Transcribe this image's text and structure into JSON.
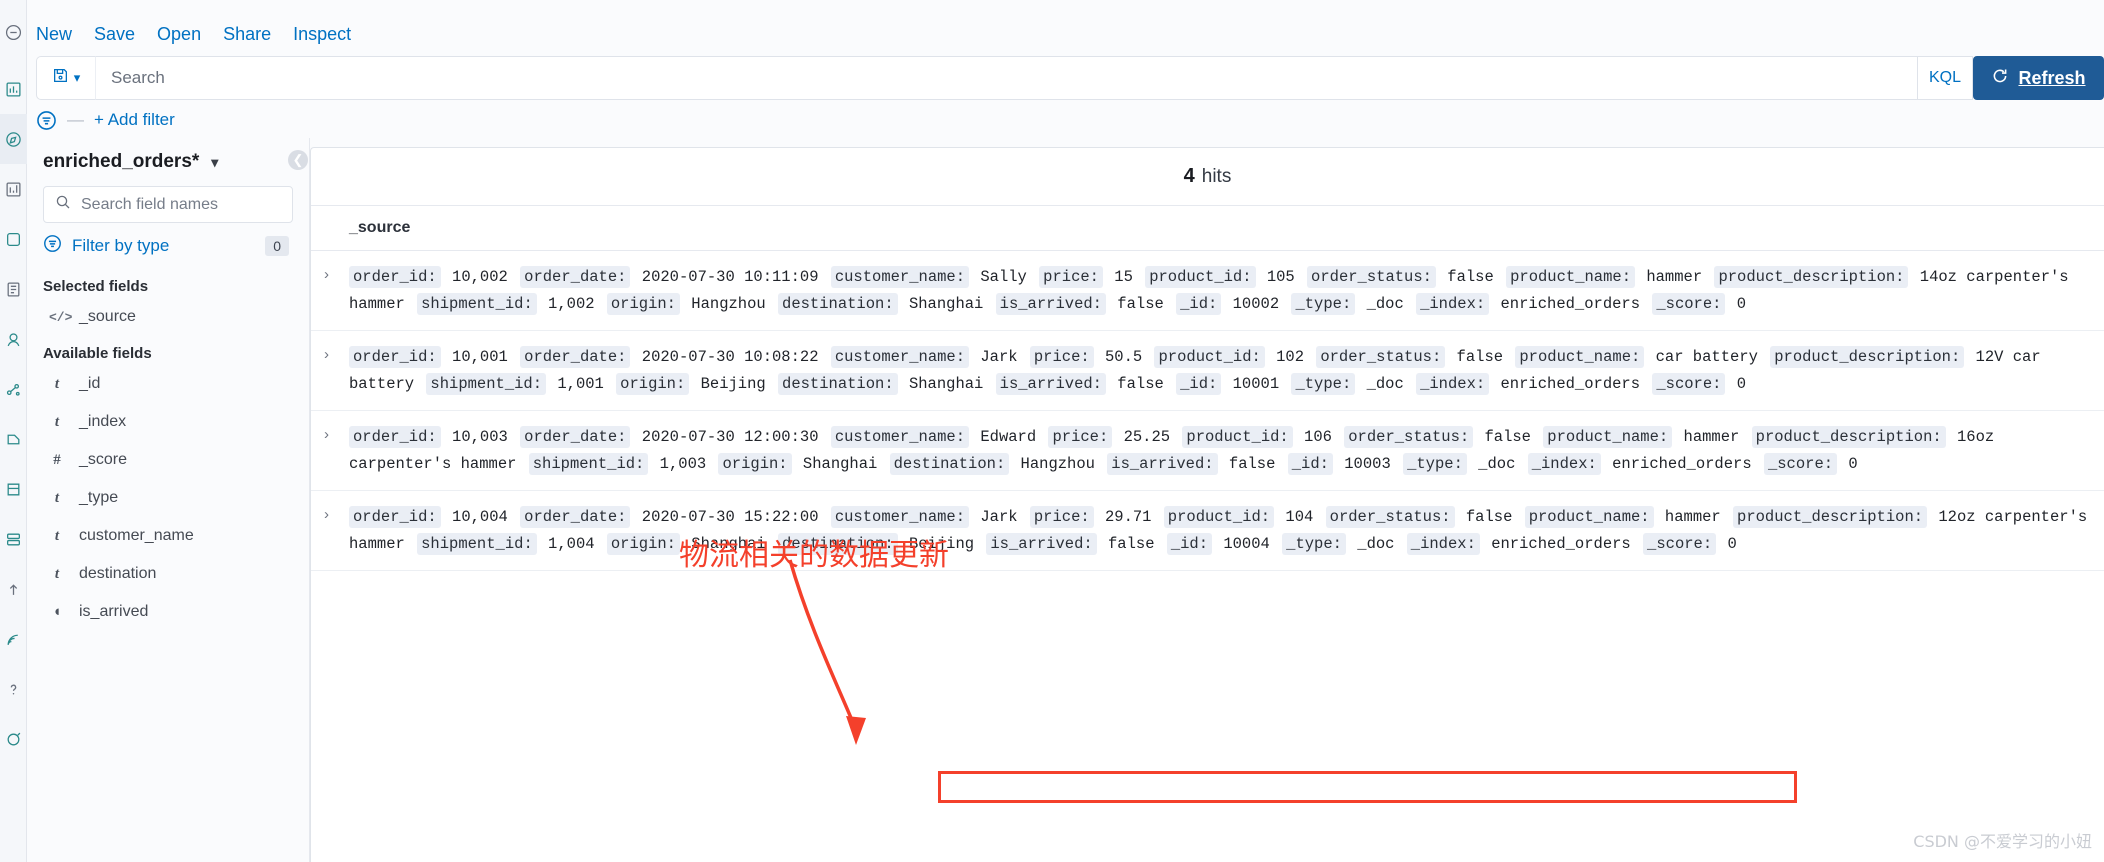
{
  "top_menu": {
    "items": [
      {
        "label": "New",
        "name": "new"
      },
      {
        "label": "Save",
        "name": "save"
      },
      {
        "label": "Open",
        "name": "open"
      },
      {
        "label": "Share",
        "name": "share"
      },
      {
        "label": "Inspect",
        "name": "inspect"
      }
    ]
  },
  "query_bar": {
    "search_placeholder": "Search",
    "language_label": "KQL",
    "refresh_label": "Refresh"
  },
  "filter_bar": {
    "add_filter_label": "+ Add filter",
    "dash": "—"
  },
  "sidebar": {
    "index_pattern": "enriched_orders*",
    "field_search_placeholder": "Search field names",
    "filter_by_type_label": "Filter by type",
    "filter_by_type_count": "0",
    "selected_fields_title": "Selected fields",
    "available_fields_title": "Available fields",
    "selected_fields": [
      {
        "name": "_source",
        "type": "source"
      }
    ],
    "available_fields": [
      {
        "name": "_id",
        "type": "string"
      },
      {
        "name": "_index",
        "type": "string"
      },
      {
        "name": "_score",
        "type": "number"
      },
      {
        "name": "_type",
        "type": "string"
      },
      {
        "name": "customer_name",
        "type": "string"
      },
      {
        "name": "destination",
        "type": "string"
      },
      {
        "name": "is_arrived",
        "type": "boolean"
      }
    ]
  },
  "main": {
    "hits_count": "4",
    "hits_label": "hits",
    "column_header": "_source",
    "documents": [
      {
        "fields": [
          {
            "key": "order_id:",
            "value": "10,002"
          },
          {
            "key": "order_date:",
            "value": "2020-07-30 10:11:09"
          },
          {
            "key": "customer_name:",
            "value": "Sally"
          },
          {
            "key": "price:",
            "value": "15"
          },
          {
            "key": "product_id:",
            "value": "105"
          },
          {
            "key": "order_status:",
            "value": "false"
          },
          {
            "key": "product_name:",
            "value": "hammer"
          },
          {
            "key": "product_description:",
            "value": "14oz carpenter's hammer"
          },
          {
            "key": "shipment_id:",
            "value": "1,002"
          },
          {
            "key": "origin:",
            "value": "Hangzhou"
          },
          {
            "key": "destination:",
            "value": "Shanghai"
          },
          {
            "key": "is_arrived:",
            "value": "false"
          },
          {
            "key": "_id:",
            "value": "10002"
          },
          {
            "key": "_type:",
            "value": "_doc"
          },
          {
            "key": "_index:",
            "value": "enriched_orders"
          },
          {
            "key": "_score:",
            "value": "0"
          }
        ]
      },
      {
        "fields": [
          {
            "key": "order_id:",
            "value": "10,001"
          },
          {
            "key": "order_date:",
            "value": "2020-07-30 10:08:22"
          },
          {
            "key": "customer_name:",
            "value": "Jark"
          },
          {
            "key": "price:",
            "value": "50.5"
          },
          {
            "key": "product_id:",
            "value": "102"
          },
          {
            "key": "order_status:",
            "value": "false"
          },
          {
            "key": "product_name:",
            "value": "car battery"
          },
          {
            "key": "product_description:",
            "value": "12V car battery"
          },
          {
            "key": "shipment_id:",
            "value": "1,001"
          },
          {
            "key": "origin:",
            "value": "Beijing"
          },
          {
            "key": "destination:",
            "value": "Shanghai"
          },
          {
            "key": "is_arrived:",
            "value": "false"
          },
          {
            "key": "_id:",
            "value": "10001"
          },
          {
            "key": "_type:",
            "value": "_doc"
          },
          {
            "key": "_index:",
            "value": "enriched_orders"
          },
          {
            "key": "_score:",
            "value": "0"
          }
        ]
      },
      {
        "fields": [
          {
            "key": "order_id:",
            "value": "10,003"
          },
          {
            "key": "order_date:",
            "value": "2020-07-30 12:00:30"
          },
          {
            "key": "customer_name:",
            "value": "Edward"
          },
          {
            "key": "price:",
            "value": "25.25"
          },
          {
            "key": "product_id:",
            "value": "106"
          },
          {
            "key": "order_status:",
            "value": "false"
          },
          {
            "key": "product_name:",
            "value": "hammer"
          },
          {
            "key": "product_description:",
            "value": "16oz carpenter's hammer"
          },
          {
            "key": "shipment_id:",
            "value": "1,003"
          },
          {
            "key": "origin:",
            "value": "Shanghai"
          },
          {
            "key": "destination:",
            "value": "Hangzhou"
          },
          {
            "key": "is_arrived:",
            "value": "false"
          },
          {
            "key": "_id:",
            "value": "10003"
          },
          {
            "key": "_type:",
            "value": "_doc"
          },
          {
            "key": "_index:",
            "value": "enriched_orders"
          },
          {
            "key": "_score:",
            "value": "0"
          }
        ]
      },
      {
        "fields": [
          {
            "key": "order_id:",
            "value": "10,004"
          },
          {
            "key": "order_date:",
            "value": "2020-07-30 15:22:00"
          },
          {
            "key": "customer_name:",
            "value": "Jark"
          },
          {
            "key": "price:",
            "value": "29.71"
          },
          {
            "key": "product_id:",
            "value": "104"
          },
          {
            "key": "order_status:",
            "value": "false"
          },
          {
            "key": "product_name:",
            "value": "hammer"
          },
          {
            "key": "product_description:",
            "value": "12oz carpenter's hammer"
          },
          {
            "key": "shipment_id:",
            "value": "1,004"
          },
          {
            "key": "origin:",
            "value": "Shanghai"
          },
          {
            "key": "destination:",
            "value": "Beijing"
          },
          {
            "key": "is_arrived:",
            "value": "false"
          },
          {
            "key": "_id:",
            "value": "10004"
          },
          {
            "key": "_type:",
            "value": "_doc"
          },
          {
            "key": "_index:",
            "value": "enriched_orders"
          },
          {
            "key": "_score:",
            "value": "0"
          }
        ]
      }
    ]
  },
  "annotations": {
    "note_text": "物流相关的数据更新",
    "note_color": "#f4402b",
    "highlight_color": "#f4402b"
  },
  "watermark": "CSDN @不爱学习的小妞"
}
